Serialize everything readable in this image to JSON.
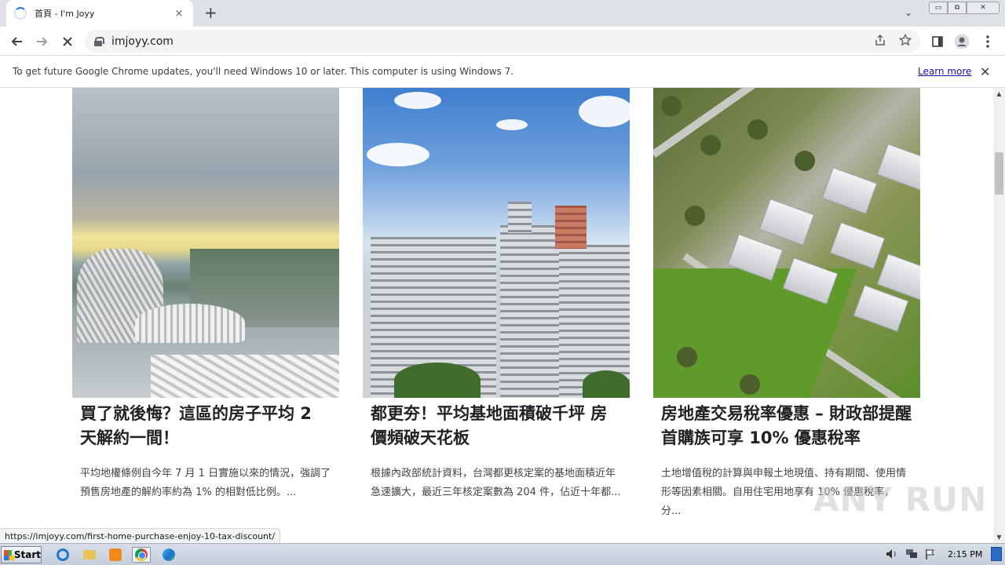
{
  "browser": {
    "tab": {
      "title": "首頁 - I'm Joyy",
      "close_label": "×"
    },
    "new_tab_label": "+",
    "tab_search_label": "⌄",
    "url": "imjoyy.com",
    "window_controls": {
      "minimize": "▭",
      "maximize": "⧉",
      "close": "✕"
    }
  },
  "infobar": {
    "message": "To get future Google Chrome updates, you'll need Windows 10 or later. This computer is using Windows 7.",
    "link_label": "Learn more",
    "close_label": "✕"
  },
  "articles": [
    {
      "title": "買了就後悔？這區的房子平均 2 天解約一間！",
      "excerpt": "平均地權條例自今年 7 月 1 日實施以來的情況，強調了預售房地產的解約率約為 1% 的相對低比例。..."
    },
    {
      "title": "都更夯！平均基地面積破千坪 房價頻破天花板",
      "excerpt": "根據內政部統計資料，台灣都更核定案的基地面積近年急速擴大，最近三年核定案數為 204 件，佔近十年都..."
    },
    {
      "title": "房地產交易稅率優惠 – 財政部提醒首購族可享 10% 優惠稅率",
      "excerpt": "土地增值稅的計算與申報土地現值、持有期間、使用情形等因素相關。自用住宅用地享有 10% 優惠稅率，分..."
    }
  ],
  "status_url": "https://imjoyy.com/first-home-purchase-enjoy-10-tax-discount/",
  "watermark": "ANY RUN",
  "taskbar": {
    "start_label": "Start",
    "clock": "2:15 PM"
  }
}
